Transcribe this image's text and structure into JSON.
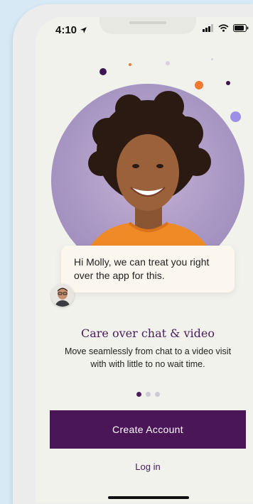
{
  "status_bar": {
    "time": "4:10",
    "location_icon": "location-arrow-icon",
    "signal_icon": "cellular-signal-icon",
    "wifi_icon": "wifi-icon",
    "battery_icon": "battery-icon"
  },
  "hero": {
    "image": "smiling-woman-portrait",
    "chat_message": "Hi Molly, we can treat you right over the app for this.",
    "doctor_avatar": "doctor-avatar"
  },
  "onboarding": {
    "title": "Care over chat & video",
    "description": "Move seamlessly from chat to a video visit with with little to no wait time.",
    "page_count": 3,
    "current_page": 1
  },
  "actions": {
    "create_account_label": "Create Account",
    "login_label": "Log in"
  },
  "colors": {
    "brand_purple": "#4a1658",
    "background": "#f2f2ec",
    "accent_orange": "#f07a2e",
    "accent_lavender": "#9b8fe8"
  }
}
